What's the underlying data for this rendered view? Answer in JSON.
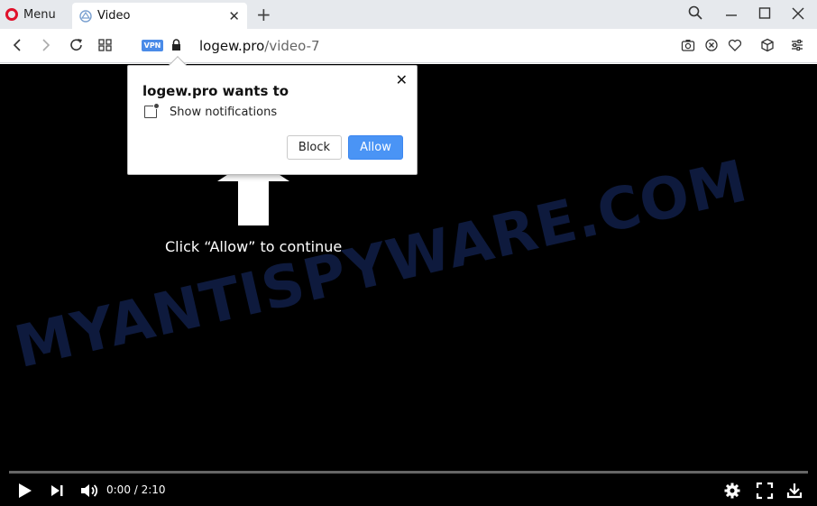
{
  "tabbar": {
    "menu_label": "Menu",
    "tab_title": "Video"
  },
  "address": {
    "vpn_badge": "VPN",
    "domain": "logew.pro",
    "path": "/video-7"
  },
  "popup": {
    "title": "logew.pro wants to",
    "permission": "Show notifications",
    "block_label": "Block",
    "allow_label": "Allow"
  },
  "page": {
    "cta": "Click “Allow” to continue",
    "watermark": "MYANTISPYWARE.COM"
  },
  "player": {
    "time": "0:00 / 2:10",
    "progress": 0
  },
  "colors": {
    "opera_red": "#e0112b",
    "allow_blue": "#4a94f5",
    "vpn_blue": "#4a8be8",
    "watermark": "#0e1a3d"
  }
}
